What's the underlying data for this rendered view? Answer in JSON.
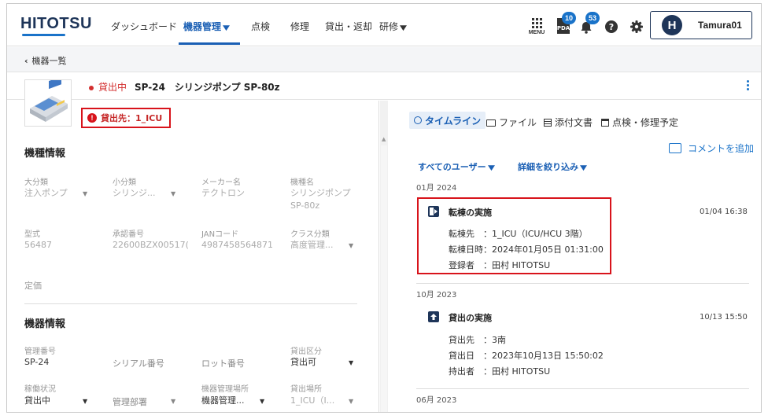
{
  "nav": {
    "logo": "HITOTSU",
    "items": [
      {
        "label": "ダッシュボード"
      },
      {
        "label": "機器管理",
        "active": true
      },
      {
        "label": "点検"
      },
      {
        "label": "修理"
      },
      {
        "label": "貸出・返却"
      },
      {
        "label": "研修"
      }
    ],
    "menu_label": "MENU",
    "badges": {
      "first": "10",
      "notifications": "53"
    },
    "user": {
      "initial": "H",
      "name": "Tamura01"
    }
  },
  "breadcrumb": {
    "back_label": "機器一覧"
  },
  "header": {
    "status": "貸出中",
    "device_title": "SP-24　シリンジポンプ SP-80z"
  },
  "lend_badge": "貸出先：1_ICU",
  "model_info": {
    "title": "機種情報",
    "fields": [
      {
        "label": "大分類",
        "value": "注入ポンプ"
      },
      {
        "label": "小分類",
        "value": "シリンジ..."
      },
      {
        "label": "メーカー名",
        "value": "テクトロン"
      },
      {
        "label": "機種名",
        "value": "シリンジポンプ SP-80z"
      },
      {
        "label": "型式",
        "value": "56487"
      },
      {
        "label": "承認番号",
        "value": "22600BZX00517("
      },
      {
        "label": "JANコード",
        "value": "4987458564871"
      },
      {
        "label": "クラス分類",
        "value": "高度管理..."
      },
      {
        "label": "定価",
        "value": ""
      }
    ]
  },
  "device_info": {
    "title": "機器情報",
    "fields": [
      {
        "label": "管理番号",
        "value": "SP-24"
      },
      {
        "label": "",
        "value": "シリアル番号"
      },
      {
        "label": "",
        "value": "ロット番号"
      },
      {
        "label": "貸出区分",
        "value": "貸出可"
      },
      {
        "label": "稼働状況",
        "value": "貸出中"
      },
      {
        "label": "",
        "value": "管理部署"
      },
      {
        "label": "機器管理場所",
        "value": "機器管理..."
      },
      {
        "label": "貸出場所",
        "value": "1_ICU（I..."
      }
    ]
  },
  "tabs": {
    "timeline": "タイムライン",
    "files": "ファイル",
    "attachments": "添付文書",
    "schedule": "点検・修理予定"
  },
  "comment_link": "コメントを追加",
  "filters": {
    "users": "すべてのユーザー",
    "detail": "詳細を絞り込み"
  },
  "timeline": {
    "groups": [
      {
        "month": "01月 2024",
        "event": {
          "title": "転棟の実施",
          "time": "01/04 16:38",
          "lines": [
            "転棟先　：1_ICU（ICU/HCU 3階）",
            "転棟日時：2024年01月05日 01:31:00",
            "登録者　：田村 HITOTSU"
          ]
        }
      },
      {
        "month": "10月 2023",
        "event": {
          "title": "貸出の実施",
          "time": "10/13 15:50",
          "lines": [
            "貸出先　：3南",
            "貸出日　：2023年10月13日 15:50:02",
            "持出者　：田村 HITOTSU"
          ]
        }
      },
      {
        "month": "06月 2023"
      }
    ]
  },
  "colors": {
    "brand": "#1e3559",
    "accent": "#1a73c9",
    "alert": "#d8131b"
  }
}
